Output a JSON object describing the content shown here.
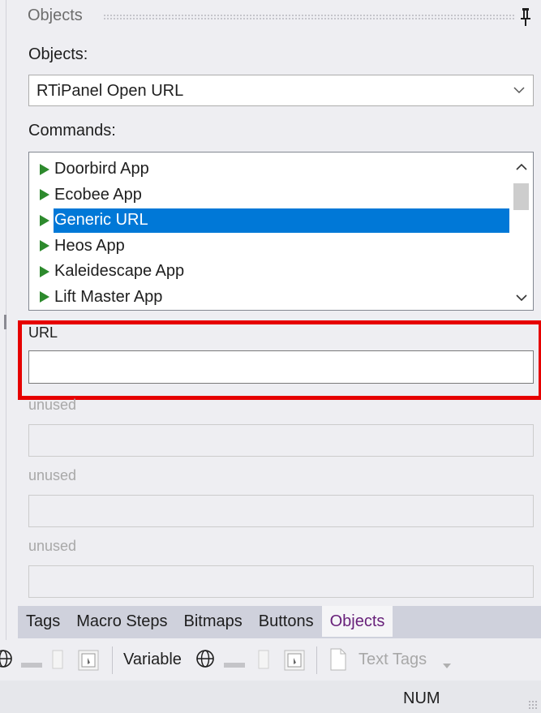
{
  "panel": {
    "title": "Objects",
    "objects_label": "Objects:",
    "objects_value": "RTiPanel Open URL",
    "commands_label": "Commands:",
    "commands": [
      {
        "label": "Doorbird App",
        "selected": false
      },
      {
        "label": "Ecobee App",
        "selected": false
      },
      {
        "label": "Generic URL",
        "selected": true
      },
      {
        "label": "Heos App",
        "selected": false
      },
      {
        "label": "Kaleidescape App",
        "selected": false
      },
      {
        "label": "Lift Master App",
        "selected": false
      }
    ],
    "fields": [
      {
        "label": "URL",
        "value": "",
        "enabled": true
      },
      {
        "label": "unused",
        "value": "",
        "enabled": false
      },
      {
        "label": "unused",
        "value": "",
        "enabled": false
      },
      {
        "label": "unused",
        "value": "",
        "enabled": false
      }
    ]
  },
  "tabs": [
    {
      "label": "Tags",
      "active": false
    },
    {
      "label": "Macro Steps",
      "active": false
    },
    {
      "label": "Bitmaps",
      "active": false
    },
    {
      "label": "Buttons",
      "active": false
    },
    {
      "label": "Objects",
      "active": true
    }
  ],
  "toolbar": {
    "variable_label": "Variable",
    "text_tags_label": "Text Tags"
  },
  "status": {
    "num": "NUM"
  },
  "colors": {
    "selection": "#0078d7",
    "highlight_border": "#e60000",
    "play_green": "#2d8a2d",
    "active_tab_text": "#68217a"
  }
}
